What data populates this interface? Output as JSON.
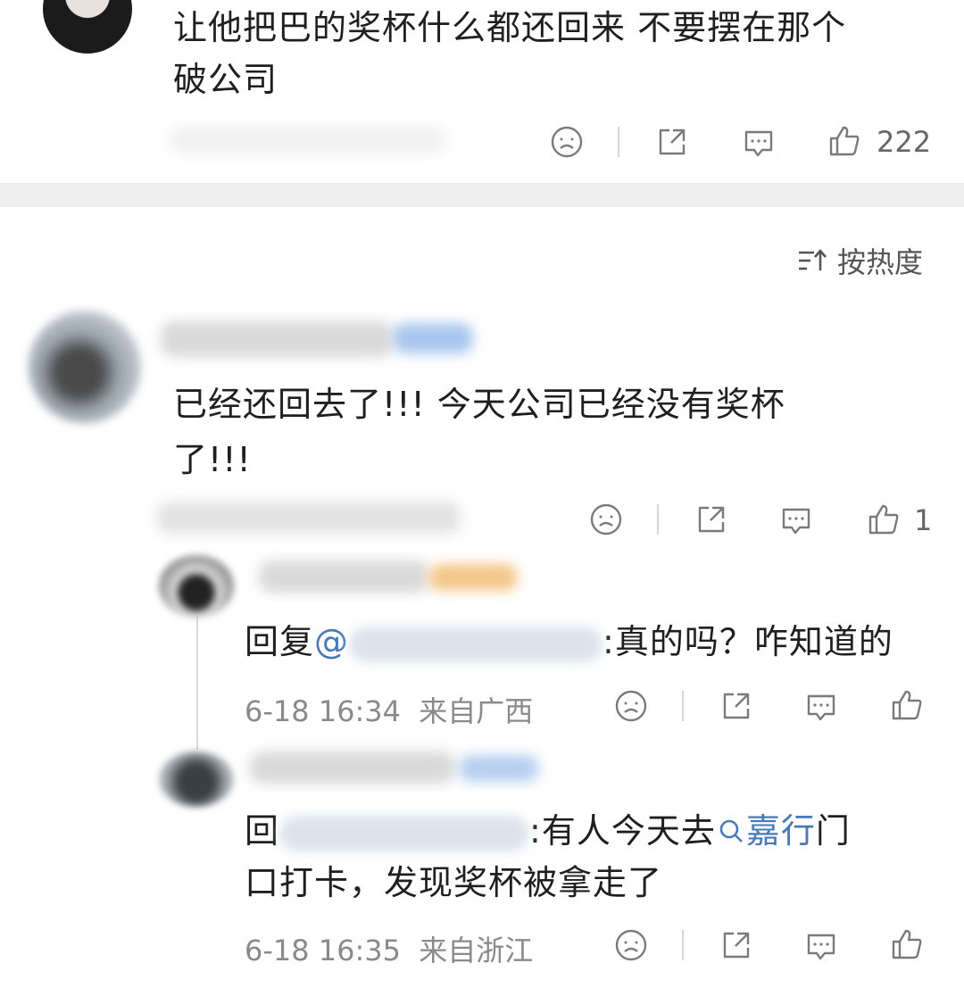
{
  "post": {
    "text_line1": "让他把巴的奖杯什么都还回来 不要摆在那个",
    "text_line2": "破公司",
    "like_count": "222"
  },
  "sort": {
    "label": "按热度",
    "icon": "sort-icon"
  },
  "comments": [
    {
      "text_line1": "已经还回去了!!! 今天公司已经没有奖杯",
      "text_line2": "了!!!",
      "like_count": "1"
    }
  ],
  "replies": [
    {
      "prefix": "回复",
      "at": "@",
      "body": ":真的吗？咋知道的",
      "timestamp": "6-18 16:34",
      "location": "来自广西"
    },
    {
      "prefix": "回",
      "body_line1": ":有人今天去",
      "link_icon": "search-icon",
      "link_text": "嘉行",
      "body_tail": "门",
      "body_line2": "口打卡，发现奖杯被拿走了",
      "timestamp": "6-18 16:35",
      "location": "来自浙江"
    }
  ],
  "colors": {
    "link": "#4a79b8",
    "meta": "#8a8a8a",
    "divider": "#eeeeee"
  }
}
